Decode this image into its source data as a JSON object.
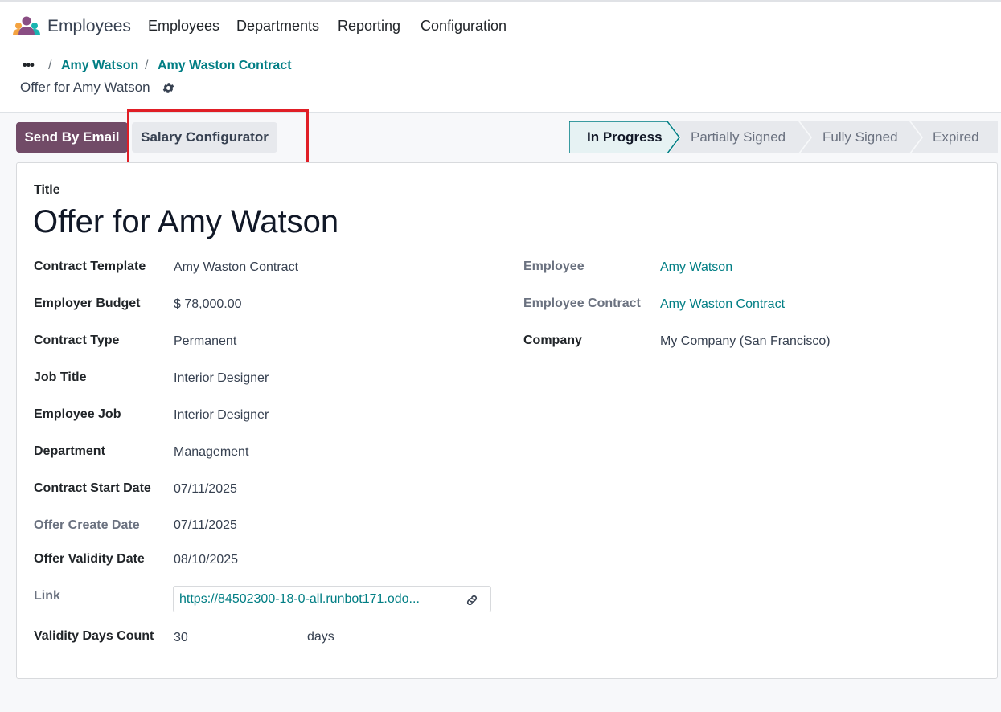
{
  "navbar": {
    "app_name": "Employees",
    "menu": [
      "Employees",
      "Departments",
      "Reporting",
      "Configuration"
    ]
  },
  "breadcrumb": {
    "ellipsis": "•••",
    "items": [
      "Amy Watson",
      "Amy Waston Contract"
    ],
    "current": "Offer for Amy Watson"
  },
  "actions": {
    "send_by_email": "Send By Email",
    "salary_configurator": "Salary Configurator"
  },
  "statusbar": {
    "stages": [
      "In Progress",
      "Partially Signed",
      "Fully Signed",
      "Expired"
    ],
    "active": "In Progress"
  },
  "form": {
    "title_label": "Title",
    "title_value": "Offer for Amy Watson",
    "left_fields": [
      {
        "label": "Contract Template",
        "value": "Amy Waston Contract"
      },
      {
        "label": "Employer Budget",
        "value": "$ 78,000.00"
      },
      {
        "label": "Contract Type",
        "value": "Permanent"
      },
      {
        "label": "Job Title",
        "value": "Interior Designer"
      },
      {
        "label": "Employee Job",
        "value": "Interior Designer"
      },
      {
        "label": "Department",
        "value": "Management"
      },
      {
        "label": "Contract Start Date",
        "value": "07/11/2025"
      },
      {
        "label": "Offer Create Date",
        "value": "07/11/2025"
      },
      {
        "label": "Offer Validity Date",
        "value": "08/10/2025"
      },
      {
        "label": "Link",
        "value": "https://84502300-18-0-all.runbot171.odo..."
      },
      {
        "label": "Validity Days Count",
        "value": "30",
        "unit": "days"
      }
    ],
    "right_fields": [
      {
        "label": "Employee",
        "value": "Amy Watson"
      },
      {
        "label": "Employee Contract",
        "value": "Amy Waston Contract"
      },
      {
        "label": "Company",
        "value": "My Company (San Francisco)"
      }
    ]
  },
  "colors": {
    "primary": "#714b67",
    "link": "#017e84",
    "highlight": "#e01e26",
    "active_stage_bg": "#e6f2f3",
    "inactive_stage_bg": "#e7e9ed"
  },
  "icons": {
    "logo": "employees-app-icon",
    "gear": "gear-icon",
    "link": "link-icon"
  }
}
